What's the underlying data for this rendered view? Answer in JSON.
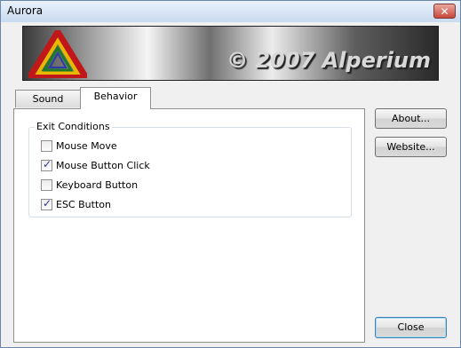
{
  "window": {
    "title": "Aurora",
    "close_glyph": "✕"
  },
  "banner": {
    "text": "© 2007 Alperium",
    "logo_icon": "triangle-logo-icon"
  },
  "tabs": [
    {
      "label": "Sound",
      "selected": false
    },
    {
      "label": "Behavior",
      "selected": true
    }
  ],
  "exit_conditions": {
    "title": "Exit Conditions",
    "options": [
      {
        "label": "Mouse Move",
        "checked": false
      },
      {
        "label": "Mouse Button Click",
        "checked": true
      },
      {
        "label": "Keyboard Button",
        "checked": false
      },
      {
        "label": "ESC Button",
        "checked": true
      }
    ]
  },
  "buttons": {
    "about": "About...",
    "website": "Website...",
    "close": "Close"
  }
}
